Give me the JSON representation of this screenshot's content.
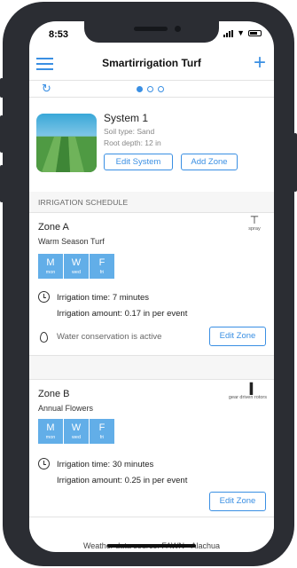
{
  "status_bar": {
    "time": "8:53"
  },
  "nav": {
    "title": "Smartirrigation Turf",
    "add_label": "+"
  },
  "pager": {
    "page_count": 3,
    "active_page": 1
  },
  "system": {
    "name": "System 1",
    "soil_type": "Soil type: Sand",
    "root_depth": "Root depth: 12 in",
    "edit_label": "Edit System",
    "add_zone_label": "Add Zone"
  },
  "schedule": {
    "header": "IRRIGATION SCHEDULE",
    "zones": [
      {
        "name": "Zone A",
        "type": "Warm Season Turf",
        "sprinkler_label": "spray",
        "days": [
          {
            "d": "M",
            "s": "mon"
          },
          {
            "d": "W",
            "s": "wed"
          },
          {
            "d": "F",
            "s": "fri"
          }
        ],
        "time": "Irrigation time: 7 minutes",
        "amount": "Irrigation amount: 0.17 in per event",
        "conservation": "Water conservation is active",
        "edit_label": "Edit Zone"
      },
      {
        "name": "Zone B",
        "type": "Annual Flowers",
        "sprinkler_label": "gear driven rotors",
        "days": [
          {
            "d": "M",
            "s": "mon"
          },
          {
            "d": "W",
            "s": "wed"
          },
          {
            "d": "F",
            "s": "fri"
          }
        ],
        "time": "Irrigation time: 30 minutes",
        "amount": "Irrigation amount: 0.25 in per event",
        "edit_label": "Edit Zone"
      }
    ]
  },
  "footer": {
    "weather_source": "Weather data source: FAWN - Alachua"
  },
  "colors": {
    "accent": "#3a8fe3",
    "day_tile": "#62aee8",
    "device": "#2b2d33"
  },
  "icons": {
    "menu": "hamburger-icon",
    "add": "plus-icon",
    "refresh": "refresh-icon",
    "clock": "clock-icon",
    "drop": "water-drop-icon",
    "spray": "spray-head-icon",
    "rotor": "rotor-head-icon"
  }
}
